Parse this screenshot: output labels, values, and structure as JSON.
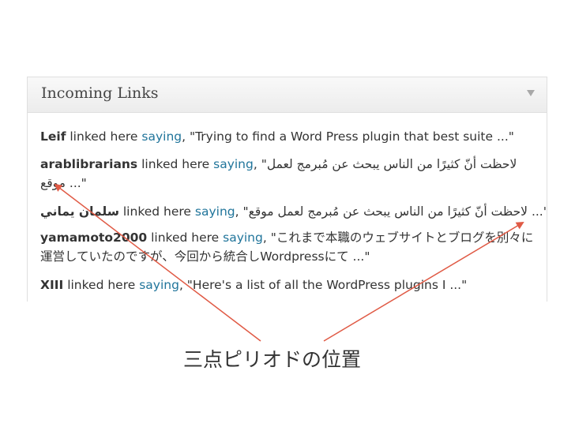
{
  "widget": {
    "title": "Incoming Links",
    "toggle_icon": "triangle-down-icon",
    "links": [
      {
        "author": "Leif",
        "linked_text": " linked here ",
        "saying_label": "saying",
        "excerpt": ", \"Trying to find a Word Press plugin that best suite ...\""
      },
      {
        "author": "arablibrarians",
        "linked_text": " linked here ",
        "saying_label": "saying",
        "excerpt": ", \"لاحظت أنّ كثيرًا من الناس يبحث عن مُبرمج لعمل موقع ...\""
      },
      {
        "author": "سلمان يماني",
        "linked_text": " linked here ",
        "saying_label": "saying",
        "excerpt": ", \"لاحظت أنّ كثيرًا من الناس يبحث عن مُبرمج لعمل موقع ...\""
      },
      {
        "author": "yamamoto2000",
        "linked_text": " linked here ",
        "saying_label": "saying",
        "excerpt": ", \"これまで本職のウェブサイトとブログを別々に運営していたのですが、今回から統合しWordpressにて ...\""
      },
      {
        "author": "XIII",
        "linked_text": " linked here ",
        "saying_label": "saying",
        "excerpt": ", \"Here's a list of all the WordPress plugins I ...\""
      }
    ]
  },
  "annotation": {
    "caption": "三点ピリオドの位置",
    "arrow_color": "#e05a45"
  }
}
